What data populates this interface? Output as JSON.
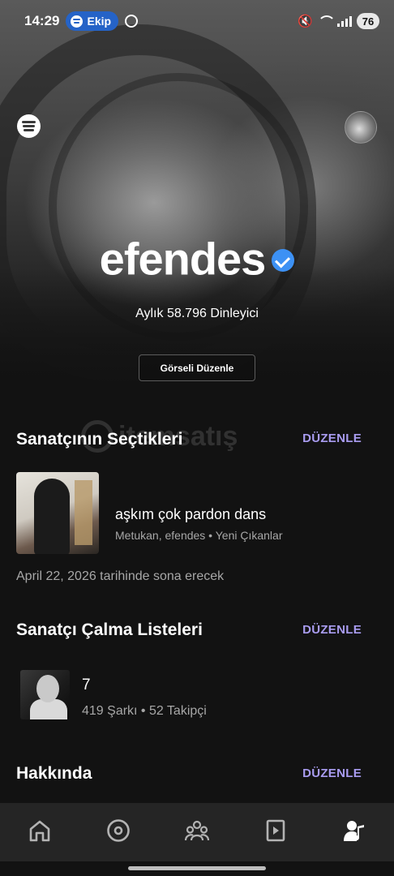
{
  "status_bar": {
    "time": "14:29",
    "ekip_label": "Ekip",
    "battery": "76"
  },
  "header": {
    "artist_name": "efendes",
    "monthly_listeners": "Aylık 58.796 Dinleyici",
    "edit_image_label": "Görseli Düzenle"
  },
  "watermark": {
    "text": "itemsatış"
  },
  "artist_pick": {
    "title": "Sanatçının Seçtikleri",
    "edit_label": "DÜZENLE",
    "track_title": "aşkım çok pardon dans",
    "track_subtitle": "Metukan, efendes • Yeni Çıkanlar",
    "expiry": "April 22, 2026 tarihinde sona erecek"
  },
  "artist_playlists": {
    "title": "Sanatçı Çalma Listeleri",
    "edit_label": "DÜZENLE",
    "playlist_title": "7",
    "playlist_subtitle": "419 Şarkı • 52 Takipçi"
  },
  "about": {
    "title": "Hakkında",
    "edit_label": "DÜZENLE"
  },
  "bottom_nav": {
    "items": [
      "home-icon",
      "music-disc-icon",
      "audience-icon",
      "video-icon",
      "profile-music-icon"
    ],
    "active": "profile-music-icon"
  },
  "colors": {
    "background": "#121212",
    "accent_edit": "#a99cf0",
    "verified": "#3d91f4",
    "ekip_pill": "#2563c7",
    "nav_bar": "#252525"
  }
}
